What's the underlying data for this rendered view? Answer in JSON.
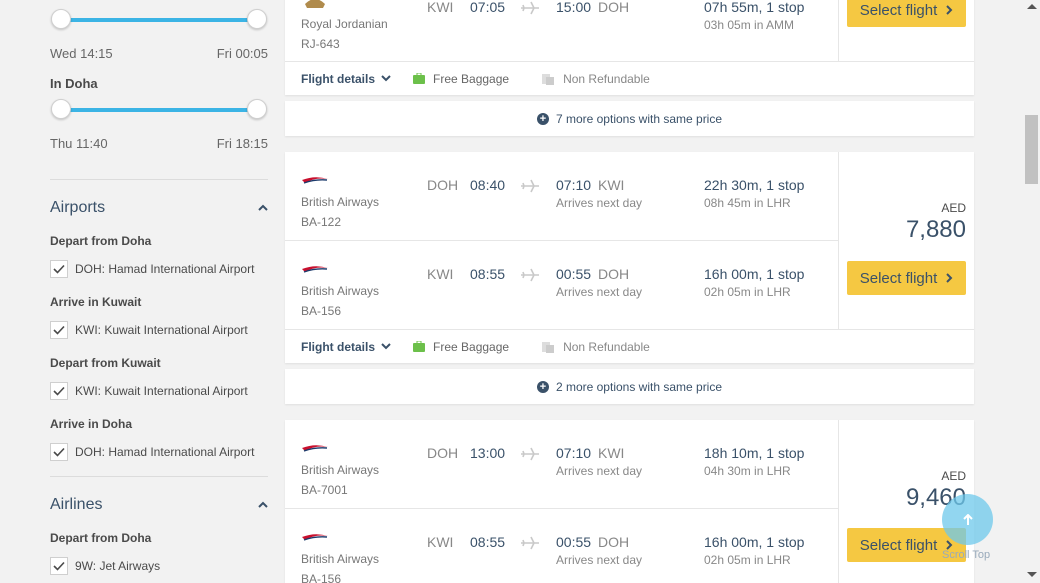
{
  "sidebar": {
    "slider1": {
      "from": "Wed 14:15",
      "to": "Fri 00:05"
    },
    "in_doha_label": "In Doha",
    "slider2": {
      "from": "Thu 11:40",
      "to": "Fri 18:15"
    },
    "airports": {
      "title": "Airports",
      "groups": [
        {
          "label": "Depart from Doha",
          "option": "DOH: Hamad International Airport"
        },
        {
          "label": "Arrive in Kuwait",
          "option": "KWI: Kuwait International Airport"
        },
        {
          "label": "Depart from Kuwait",
          "option": "KWI: Kuwait International Airport"
        },
        {
          "label": "Arrive in Doha",
          "option": "DOH: Hamad International Airport"
        }
      ]
    },
    "airlines": {
      "title": "Airlines",
      "group_label": "Depart from Doha",
      "option": "9W: Jet Airways"
    }
  },
  "card0": {
    "leg": {
      "airline": "Royal Jordanian",
      "flight": "RJ-643",
      "dep_code": "KWI",
      "dep_time": "07:05",
      "arr_time": "15:00",
      "arr_code": "DOH",
      "duration": "07h 55m, 1 stop",
      "layover": "03h 05m in  AMM"
    },
    "select_label": "Select flight",
    "details_label": "Flight details",
    "baggage": "Free Baggage",
    "refund": "Non Refundable",
    "more": "7 more options with same price"
  },
  "card1": {
    "legs": [
      {
        "airline": "British Airways",
        "flight": "BA-122",
        "dep_code": "DOH",
        "dep_time": "08:40",
        "arr_time": "07:10",
        "arr_code": "KWI",
        "arr_note": "Arrives next day",
        "duration": "22h 30m, 1 stop",
        "layover": "08h 45m in  LHR"
      },
      {
        "airline": "British Airways",
        "flight": "BA-156",
        "dep_code": "KWI",
        "dep_time": "08:55",
        "arr_time": "00:55",
        "arr_code": "DOH",
        "arr_note": "Arrives next day",
        "duration": "16h 00m, 1 stop",
        "layover": "02h 05m in  LHR"
      }
    ],
    "currency": "AED",
    "price": "7,880",
    "select_label": "Select flight",
    "details_label": "Flight details",
    "baggage": "Free Baggage",
    "refund": "Non Refundable",
    "more": "2 more options with same price"
  },
  "card2": {
    "legs": [
      {
        "airline": "British Airways",
        "flight": "BA-7001",
        "dep_code": "DOH",
        "dep_time": "13:00",
        "arr_time": "07:10",
        "arr_code": "KWI",
        "arr_note": "Arrives next day",
        "duration": "18h 10m, 1 stop",
        "layover": "04h 30m in  LHR"
      },
      {
        "airline": "British Airways",
        "flight": "BA-156",
        "dep_code": "KWI",
        "dep_time": "08:55",
        "arr_time": "00:55",
        "arr_code": "DOH",
        "arr_note": "Arrives next day",
        "duration": "16h 00m, 1 stop",
        "layover": "02h 05m in  LHR"
      }
    ],
    "currency": "AED",
    "price": "9,460",
    "select_label": "Select flight"
  },
  "scroll_top_label": "Scroll Top",
  "colors": {
    "accent": "#3cb4e5",
    "button": "#f5c842",
    "navy": "#3a5169",
    "baggage_green": "#6cc04a"
  }
}
